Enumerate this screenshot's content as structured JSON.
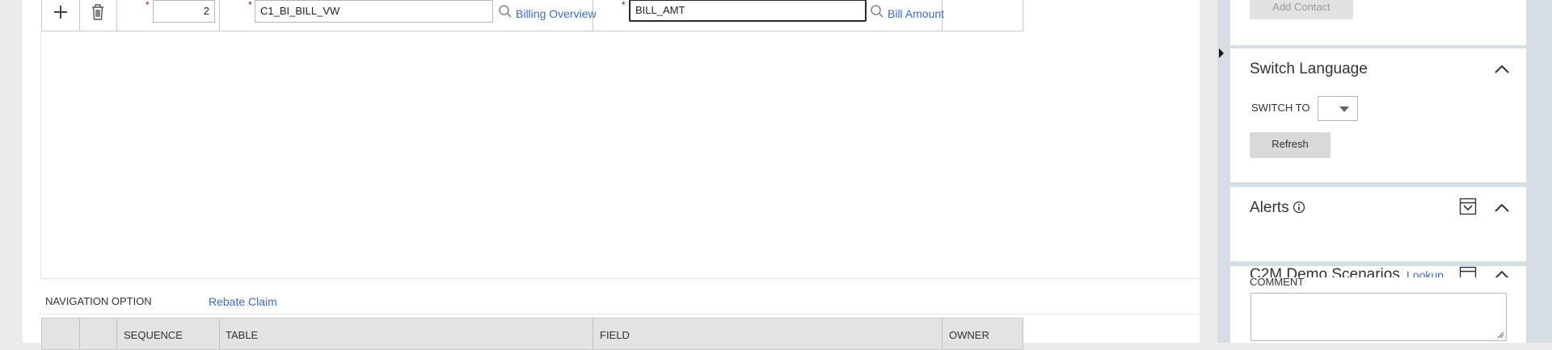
{
  "grid_row": {
    "sequence_value": "2",
    "table_value": "C1_BI_BILL_VW",
    "table_link": "Billing Overview",
    "field_value": "BILL_AMT",
    "field_link": "Bill Amount",
    "required_mark": "*"
  },
  "navigation": {
    "label": "NAVIGATION OPTION",
    "value": "Rebate Claim"
  },
  "grid_header": {
    "columns": [
      "SEQUENCE",
      "TABLE",
      "FIELD",
      "OWNER"
    ]
  },
  "right_panel": {
    "add_contact_label": "Add Contact",
    "switch_language": {
      "title": "Switch Language",
      "switch_to_label": "SWITCH TO",
      "switch_to_value": "",
      "refresh_label": "Refresh"
    },
    "alerts": {
      "title": "Alerts"
    },
    "c2m": {
      "title": "C2M Demo Scenarios",
      "lookup_label": "Lookup"
    },
    "comment": {
      "label": "COMMENT",
      "value": ""
    }
  },
  "colors": {
    "link": "#3b6bc7",
    "required": "#cc0000",
    "panel_bg": "#d6dde3"
  }
}
